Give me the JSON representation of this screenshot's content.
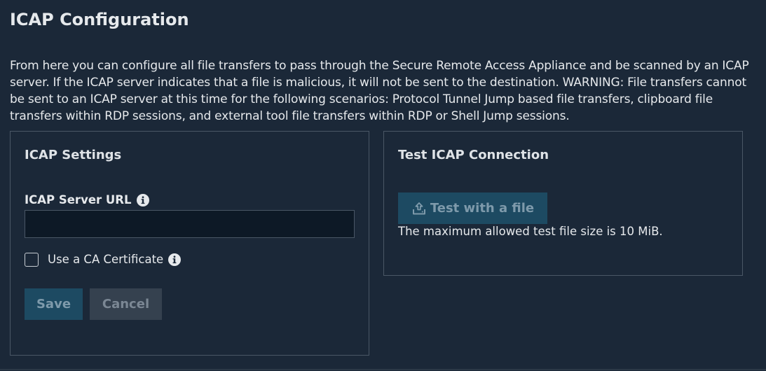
{
  "page": {
    "title": "ICAP Configuration",
    "description": "From here you can configure all file transfers to pass through the Secure Remote Access Appliance and be scanned by an ICAP server. If the ICAP server indicates that a file is malicious, it will not be sent to the destination. WARNING: File transfers cannot be sent to an ICAP server at this time for the following scenarios: Protocol Tunnel Jump based file transfers, clipboard file transfers within RDP sessions, and external tool file transfers within RDP or Shell Jump sessions."
  },
  "settings": {
    "title": "ICAP Settings",
    "server_url_label": "ICAP Server URL",
    "server_url_value": "",
    "server_url_info_icon": "info-circle-icon",
    "ca_certificate_label": "Use a CA Certificate",
    "ca_certificate_checked": false,
    "ca_certificate_info_icon": "info-circle-icon",
    "save_label": "Save",
    "cancel_label": "Cancel"
  },
  "test": {
    "title": "Test ICAP Connection",
    "button_label": "Test with a file",
    "button_icon": "upload-tray-icon",
    "note": "The maximum allowed test file size is 10 MiB."
  },
  "colors": {
    "background": "#1b2838",
    "primary_button": "#1d4a62",
    "secondary_button": "#35414f",
    "panel_border": "#4a5766",
    "input_background": "#0d1926"
  }
}
